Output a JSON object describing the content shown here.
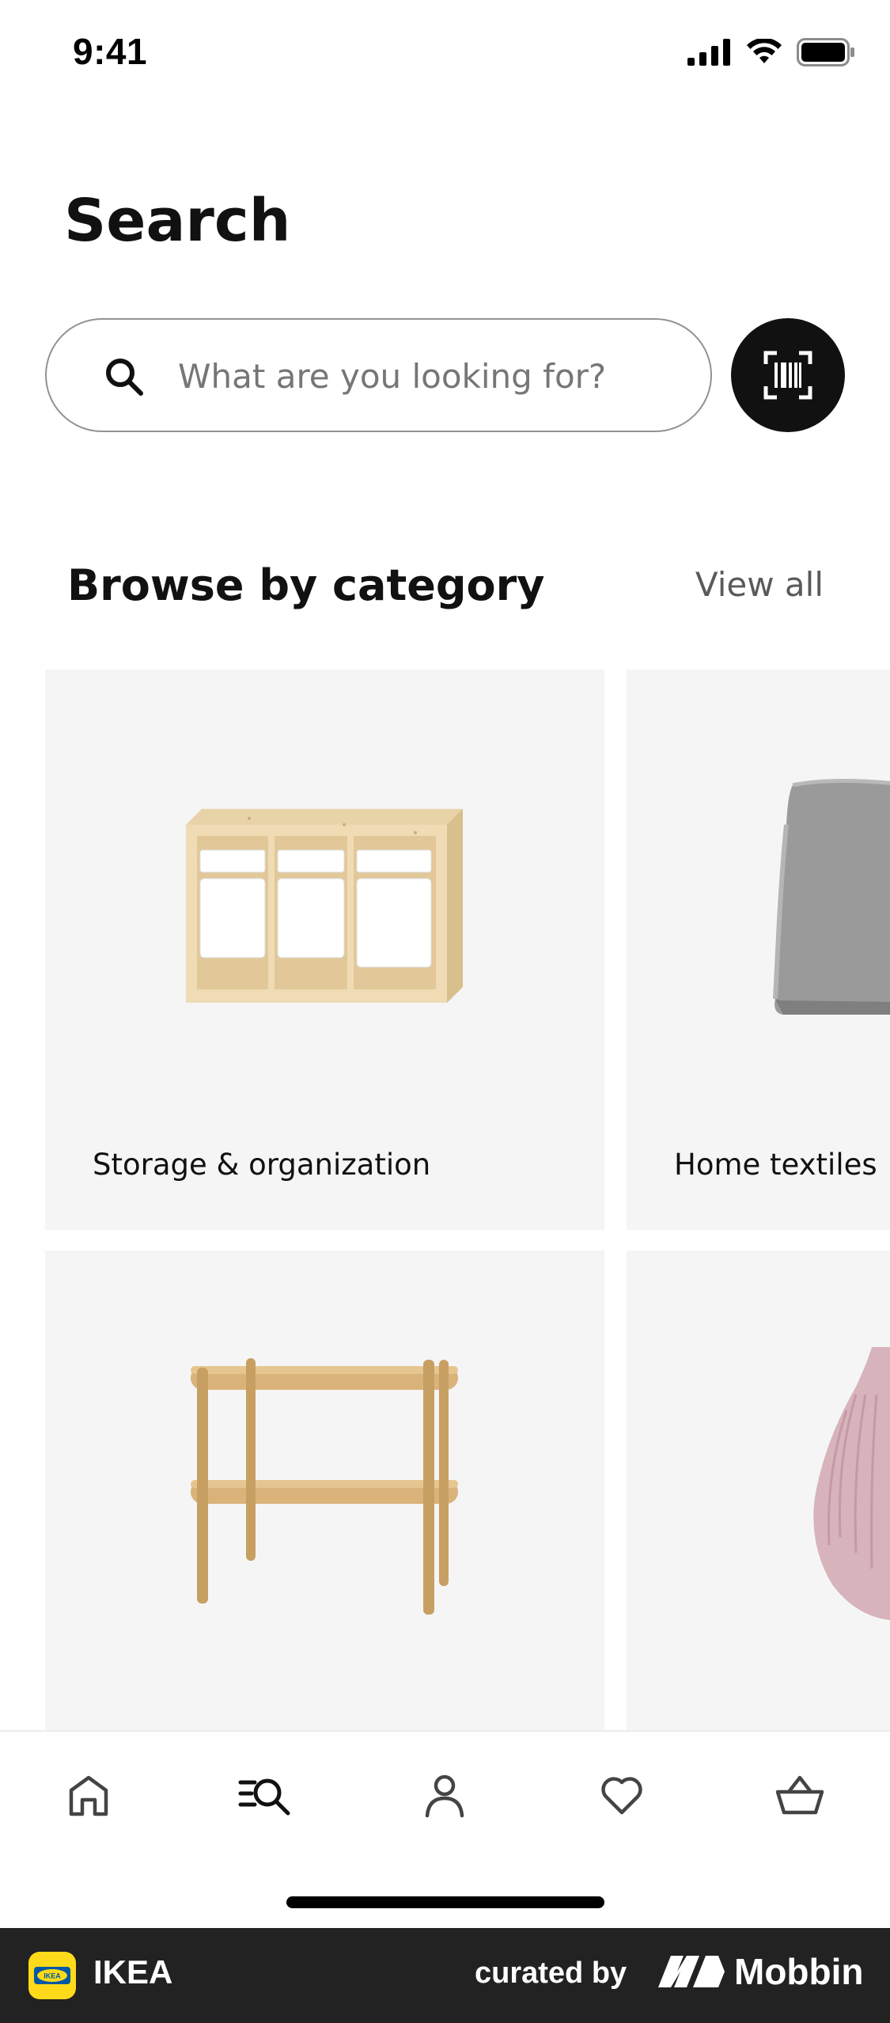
{
  "status_bar": {
    "time": "9:41"
  },
  "header": {
    "title": "Search"
  },
  "search": {
    "placeholder": "What are you looking for?",
    "value": ""
  },
  "browse": {
    "title": "Browse by category",
    "view_all_label": "View all",
    "categories": [
      {
        "label": "Storage & organization"
      },
      {
        "label": "Home textiles"
      },
      {
        "label": ""
      },
      {
        "label": ""
      }
    ]
  },
  "nav": {
    "items": [
      {
        "icon": "home-icon"
      },
      {
        "icon": "search-list-icon",
        "active": true
      },
      {
        "icon": "person-icon"
      },
      {
        "icon": "heart-icon"
      },
      {
        "icon": "basket-icon"
      }
    ]
  },
  "footer": {
    "app_name": "IKEA",
    "logo_text": "IKEA",
    "curated_by": "curated by",
    "brand": "Mobbin"
  },
  "colors": {
    "accent_dark": "#111111",
    "card_bg": "#f5f5f5",
    "ikea_yellow": "#ffda1a",
    "ikea_blue": "#0058a3",
    "footer_bg": "#222222"
  }
}
